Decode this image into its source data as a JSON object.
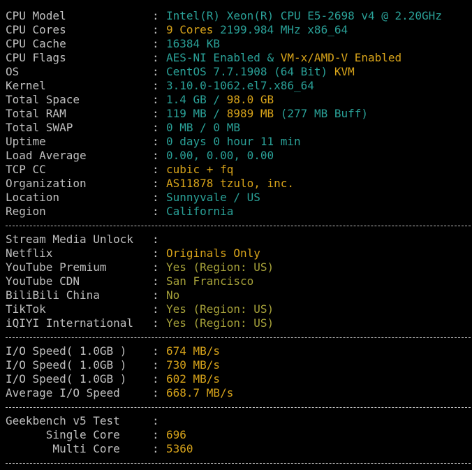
{
  "system": {
    "rows": [
      {
        "label": "CPU Model",
        "parts": [
          {
            "text": "Intel(R) Xeon(R) CPU E5-2698 v4 @ 2.20GHz",
            "color": "#2aa198"
          }
        ]
      },
      {
        "label": "CPU Cores",
        "parts": [
          {
            "text": "9 Cores",
            "color": "#d7a31a"
          },
          {
            "text": " 2199.984 MHz x86_64",
            "color": "#2aa198"
          }
        ]
      },
      {
        "label": "CPU Cache",
        "parts": [
          {
            "text": "16384 KB",
            "color": "#2aa198"
          }
        ]
      },
      {
        "label": "CPU Flags",
        "parts": [
          {
            "text": "AES-NI Enabled & ",
            "color": "#2aa198"
          },
          {
            "text": "VM-x/AMD-V Enabled",
            "color": "#d7a31a"
          }
        ]
      },
      {
        "label": "OS",
        "parts": [
          {
            "text": "CentOS 7.7.1908 (64 Bit) ",
            "color": "#2aa198"
          },
          {
            "text": "KVM",
            "color": "#d7a31a"
          }
        ]
      },
      {
        "label": "Kernel",
        "parts": [
          {
            "text": "3.10.0-1062.el7.x86_64",
            "color": "#2aa198"
          }
        ]
      },
      {
        "label": "Total Space",
        "parts": [
          {
            "text": "1.4 GB / ",
            "color": "#2aa198"
          },
          {
            "text": "98.0 GB",
            "color": "#d7a31a"
          }
        ]
      },
      {
        "label": "Total RAM",
        "parts": [
          {
            "text": "119 MB / ",
            "color": "#2aa198"
          },
          {
            "text": "8989 MB",
            "color": "#d7a31a"
          },
          {
            "text": " (277 MB Buff)",
            "color": "#2aa198"
          }
        ]
      },
      {
        "label": "Total SWAP",
        "parts": [
          {
            "text": "0 MB / 0 MB",
            "color": "#2aa198"
          }
        ]
      },
      {
        "label": "Uptime",
        "parts": [
          {
            "text": "0 days 0 hour 11 min",
            "color": "#2aa198"
          }
        ]
      },
      {
        "label": "Load Average",
        "parts": [
          {
            "text": "0.00, 0.00, 0.00",
            "color": "#2aa198"
          }
        ]
      },
      {
        "label": "TCP CC",
        "parts": [
          {
            "text": "cubic + fq",
            "color": "#d7a31a"
          }
        ]
      },
      {
        "label": "Organization",
        "parts": [
          {
            "text": "AS11878 tzulo, inc.",
            "color": "#d7a31a"
          }
        ]
      },
      {
        "label": "Location",
        "parts": [
          {
            "text": "Sunnyvale / US",
            "color": "#2aa198"
          }
        ]
      },
      {
        "label": "Region",
        "parts": [
          {
            "text": "California",
            "color": "#2aa198"
          }
        ]
      }
    ]
  },
  "media": {
    "rows": [
      {
        "label": "Stream Media Unlock",
        "parts": []
      },
      {
        "label": "Netflix",
        "parts": [
          {
            "text": "Originals Only",
            "color": "#d7a31a"
          }
        ]
      },
      {
        "label": "YouTube Premium",
        "parts": [
          {
            "text": "Yes (Region: US)",
            "color": "#a7a23a"
          }
        ]
      },
      {
        "label": "YouTube CDN",
        "parts": [
          {
            "text": "San Francisco",
            "color": "#a7a23a"
          }
        ]
      },
      {
        "label": "BiliBili China",
        "parts": [
          {
            "text": "No",
            "color": "#a7a23a"
          }
        ]
      },
      {
        "label": "TikTok",
        "parts": [
          {
            "text": "Yes (Region: US)",
            "color": "#a7a23a"
          }
        ]
      },
      {
        "label": "iQIYI International",
        "parts": [
          {
            "text": "Yes (Region: US)",
            "color": "#a7a23a"
          }
        ]
      }
    ]
  },
  "io": {
    "rows": [
      {
        "label": "I/O Speed( 1.0GB )",
        "parts": [
          {
            "text": "674 MB/s",
            "color": "#d7a31a"
          }
        ]
      },
      {
        "label": "I/O Speed( 1.0GB )",
        "parts": [
          {
            "text": "730 MB/s",
            "color": "#d7a31a"
          }
        ]
      },
      {
        "label": "I/O Speed( 1.0GB )",
        "parts": [
          {
            "text": "602 MB/s",
            "color": "#d7a31a"
          }
        ]
      },
      {
        "label": "Average I/O Speed",
        "parts": [
          {
            "text": "668.7 MB/s",
            "color": "#d7a31a"
          }
        ]
      }
    ]
  },
  "geekbench": {
    "rows": [
      {
        "label": "Geekbench v5 Test",
        "parts": []
      },
      {
        "label": "      Single Core",
        "parts": [
          {
            "text": "696",
            "color": "#d7a31a"
          }
        ]
      },
      {
        "label": "       Multi Core",
        "parts": [
          {
            "text": "5360",
            "color": "#d7a31a"
          }
        ]
      }
    ]
  },
  "separator_char": ":"
}
